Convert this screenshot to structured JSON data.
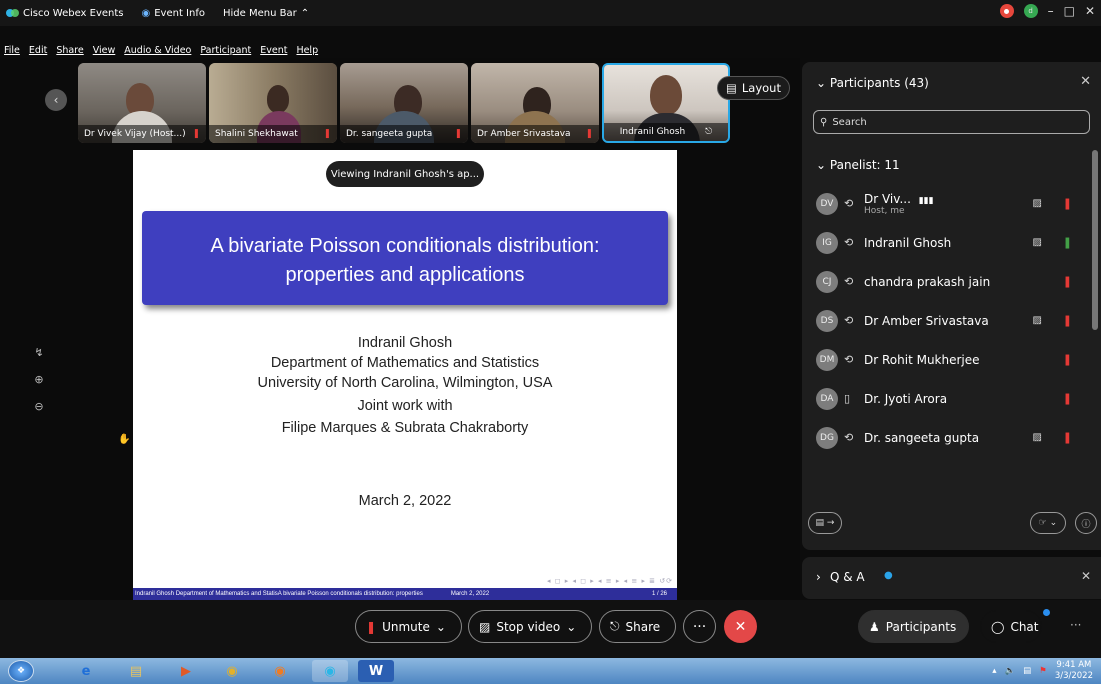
{
  "titlebar": {
    "app_name": "Cisco Webex Events",
    "event_info": "Event Info",
    "hide_menu": "Hide Menu Bar",
    "hide_menu_chevron": "⌃",
    "avatar_initials": "d"
  },
  "menu": [
    "File",
    "Edit",
    "Share",
    "View",
    "Audio & Video",
    "Participant",
    "Event",
    "Help"
  ],
  "video_strip": [
    {
      "name": "Dr Vivek Vijay  (Host...)"
    },
    {
      "name": "Shalini Shekhawat"
    },
    {
      "name": "Dr. sangeeta gupta"
    },
    {
      "name": "Dr Amber Srivastava"
    },
    {
      "name": "Indranil Ghosh"
    }
  ],
  "layout_label": "Layout",
  "viewing_label": "Viewing Indranil Ghosh's ap...",
  "slide": {
    "title_line1": "A bivariate Poisson conditionals distribution:",
    "title_line2": "properties and applications",
    "author": "Indranil Ghosh",
    "dept": "Department of Mathematics and Statistics",
    "univ": "University of North Carolina, Wilmington, USA",
    "joint": "Joint work with",
    "coauthors": "Filipe Marques & Subrata Chakraborty",
    "date": "March 2, 2022",
    "footer_left": "Indranil Ghosh  Department of Mathematics and StatisA bivariate Poisson conditionals distribution: properties",
    "footer_date": "March 2, 2022",
    "footer_page": "1 / 26",
    "nav": "◂ ◻ ▸ ◂ ◻ ▸ ◂ ≡ ▸ ◂ ≡ ▸  ≣  ↺⟳"
  },
  "controls": {
    "unmute": "Unmute",
    "stop_video": "Stop video",
    "share": "Share",
    "more": "···",
    "leave": "✕",
    "participants": "Participants",
    "chat": "Chat",
    "overflow": "···"
  },
  "panel": {
    "header": "Participants (43)",
    "search_placeholder": "Search",
    "section": "Panelist: 11",
    "people": [
      {
        "initials": "DV",
        "audio": "⟲",
        "name": "Dr Viv...",
        "sub": "Host, me",
        "video": true,
        "mic": "off"
      },
      {
        "initials": "IG",
        "audio": "⟲",
        "name": "Indranil Ghosh",
        "sub": "",
        "video": true,
        "mic": "on"
      },
      {
        "initials": "CJ",
        "audio": "⟲",
        "name": "chandra prakash jain",
        "sub": "",
        "video": false,
        "mic": "off"
      },
      {
        "initials": "DS",
        "audio": "⟲",
        "name": "Dr Amber Srivastava",
        "sub": "",
        "video": true,
        "mic": "off"
      },
      {
        "initials": "DM",
        "audio": "⟲",
        "name": "Dr Rohit Mukherjee",
        "sub": "",
        "video": false,
        "mic": "off"
      },
      {
        "initials": "DA",
        "audio": "▯",
        "name": "Dr. Jyoti Arora",
        "sub": "",
        "video": false,
        "mic": "off"
      },
      {
        "initials": "DG",
        "audio": "⟲",
        "name": "Dr. sangeeta gupta",
        "sub": "",
        "video": true,
        "mic": "off"
      }
    ],
    "qa_label": "Q & A",
    "qa_dot": "●"
  },
  "taskbar": {
    "time": "9:41 AM",
    "date": "3/3/2022"
  }
}
